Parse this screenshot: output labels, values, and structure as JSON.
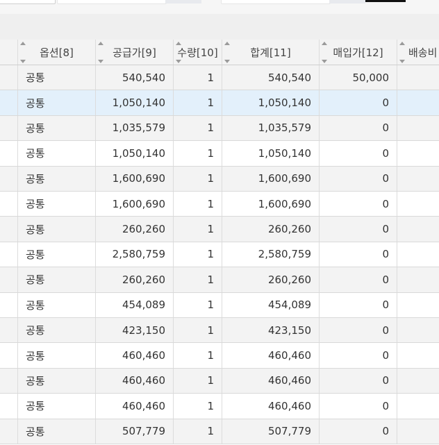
{
  "header": {
    "columns": [
      {
        "key": "option",
        "label": "옵션[8]"
      },
      {
        "key": "supply",
        "label": "공급가[9]"
      },
      {
        "key": "qty",
        "label": "수량[10]"
      },
      {
        "key": "total",
        "label": "합계[11]"
      },
      {
        "key": "purchase",
        "label": "매입가[12]"
      },
      {
        "key": "shipping",
        "label": "배송비"
      }
    ]
  },
  "rows": [
    {
      "option": "공통",
      "supply": "540,540",
      "qty": "1",
      "total": "540,540",
      "purchase": "50,000",
      "shipping": ""
    },
    {
      "option": "공통",
      "supply": "1,050,140",
      "qty": "1",
      "total": "1,050,140",
      "purchase": "0",
      "shipping": ""
    },
    {
      "option": "공통",
      "supply": "1,035,579",
      "qty": "1",
      "total": "1,035,579",
      "purchase": "0",
      "shipping": ""
    },
    {
      "option": "공통",
      "supply": "1,050,140",
      "qty": "1",
      "total": "1,050,140",
      "purchase": "0",
      "shipping": ""
    },
    {
      "option": "공통",
      "supply": "1,600,690",
      "qty": "1",
      "total": "1,600,690",
      "purchase": "0",
      "shipping": ""
    },
    {
      "option": "공통",
      "supply": "1,600,690",
      "qty": "1",
      "total": "1,600,690",
      "purchase": "0",
      "shipping": ""
    },
    {
      "option": "공통",
      "supply": "260,260",
      "qty": "1",
      "total": "260,260",
      "purchase": "0",
      "shipping": ""
    },
    {
      "option": "공통",
      "supply": "2,580,759",
      "qty": "1",
      "total": "2,580,759",
      "purchase": "0",
      "shipping": ""
    },
    {
      "option": "공통",
      "supply": "260,260",
      "qty": "1",
      "total": "260,260",
      "purchase": "0",
      "shipping": ""
    },
    {
      "option": "공통",
      "supply": "454,089",
      "qty": "1",
      "total": "454,089",
      "purchase": "0",
      "shipping": ""
    },
    {
      "option": "공통",
      "supply": "423,150",
      "qty": "1",
      "total": "423,150",
      "purchase": "0",
      "shipping": ""
    },
    {
      "option": "공통",
      "supply": "460,460",
      "qty": "1",
      "total": "460,460",
      "purchase": "0",
      "shipping": ""
    },
    {
      "option": "공통",
      "supply": "460,460",
      "qty": "1",
      "total": "460,460",
      "purchase": "0",
      "shipping": ""
    },
    {
      "option": "공통",
      "supply": "460,460",
      "qty": "1",
      "total": "460,460",
      "purchase": "0",
      "shipping": ""
    },
    {
      "option": "공통",
      "supply": "507,779",
      "qty": "1",
      "total": "507,779",
      "purchase": "0",
      "shipping": ""
    }
  ],
  "selected_row": 1,
  "colors": {
    "selected": "#e3f0fb",
    "stripe": "#f3f3f3",
    "border": "#d9d9d9"
  }
}
